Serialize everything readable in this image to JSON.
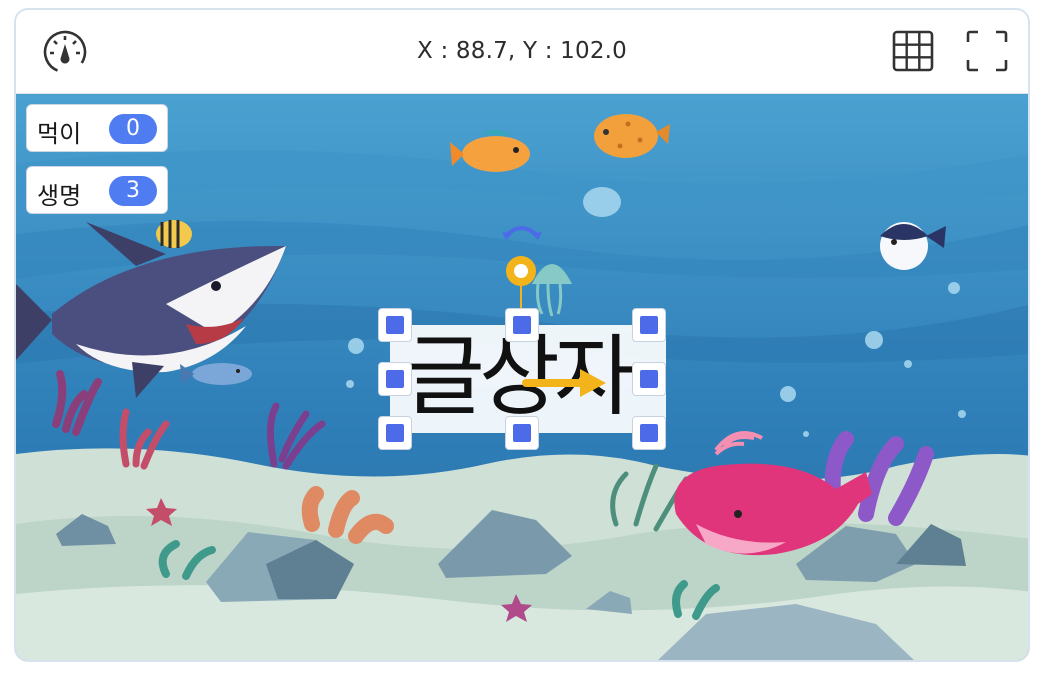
{
  "toolbar": {
    "coordinates": "X : 88.7, Y : 102.0",
    "speed_icon": "speedometer-icon",
    "grid_icon": "grid-icon",
    "fullscreen_icon": "fullscreen-icon"
  },
  "variables": [
    {
      "label": "먹이",
      "value": "0"
    },
    {
      "label": "생명",
      "value": "3"
    }
  ],
  "textbox": {
    "text": "글상자"
  },
  "colors": {
    "accent": "#4f7cf0",
    "handle": "#4d6be8",
    "rotation_handle": "#f2b31b",
    "ocean_top": "#3a93c4",
    "sand": "#cfe0d6"
  }
}
